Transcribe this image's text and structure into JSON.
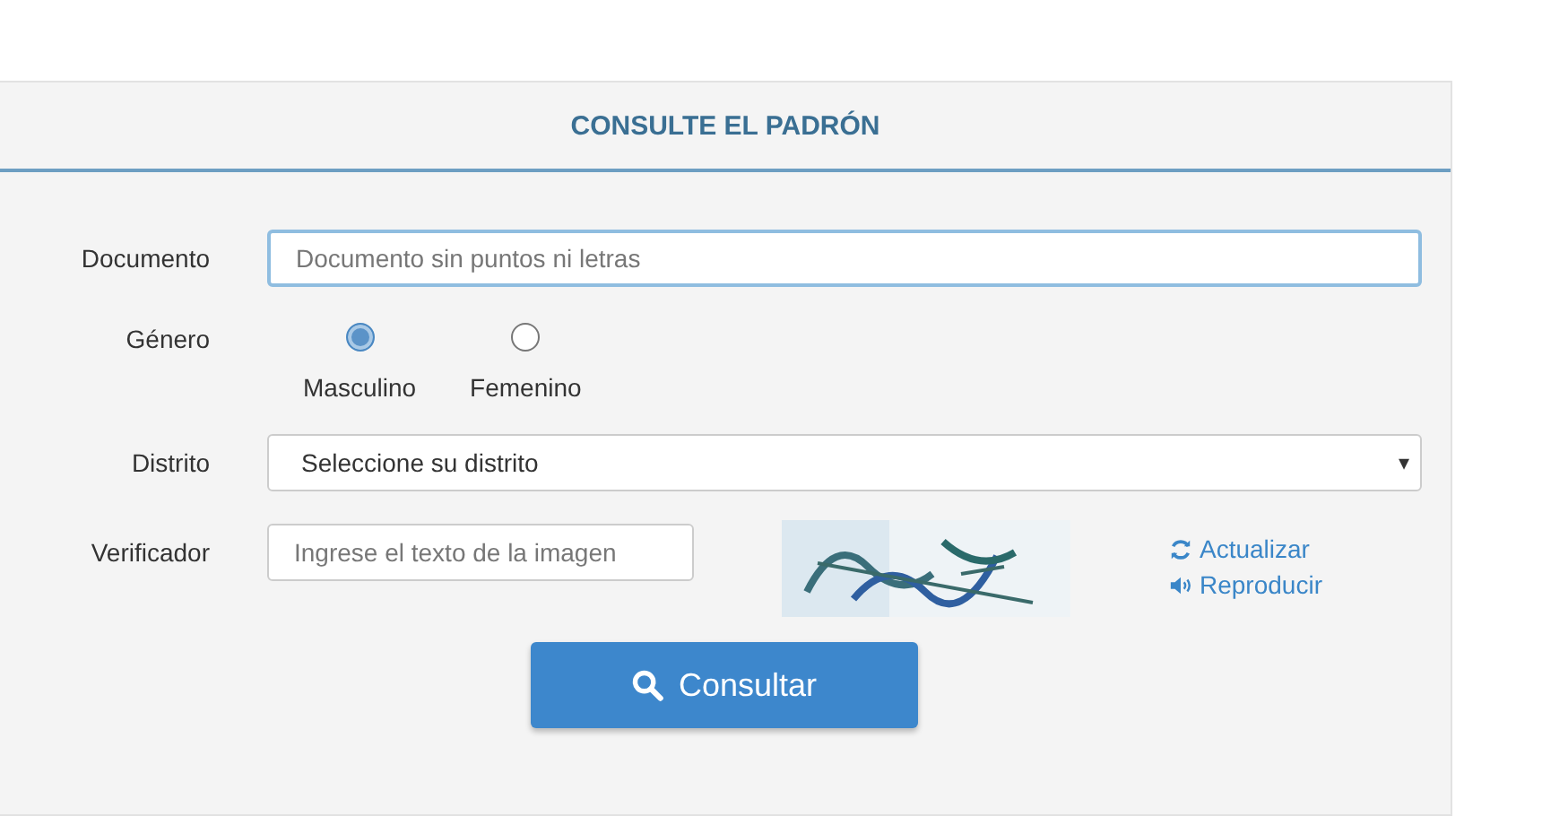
{
  "panel": {
    "title": "CONSULTE EL PADRÓN"
  },
  "rows": [
    {
      "kind": "text",
      "label": "Documento",
      "placeholder": "Documento sin puntos ni letras",
      "focused": true
    },
    {
      "kind": "radio",
      "label": "Género",
      "options": [
        {
          "label": "Masculino",
          "selected": true
        },
        {
          "label": "Femenino",
          "selected": false
        }
      ]
    },
    {
      "kind": "select",
      "label": "Distrito",
      "value": "Seleccione su distrito",
      "caret": "▾"
    },
    {
      "kind": "captcha",
      "label": "Verificador",
      "placeholder": "Ingrese el texto de la imagen",
      "links": [
        {
          "kind": "refresh",
          "label": "Actualizar"
        },
        {
          "kind": "audio",
          "label": "Reproducir"
        }
      ]
    }
  ],
  "submit": {
    "label": "Consultar"
  }
}
